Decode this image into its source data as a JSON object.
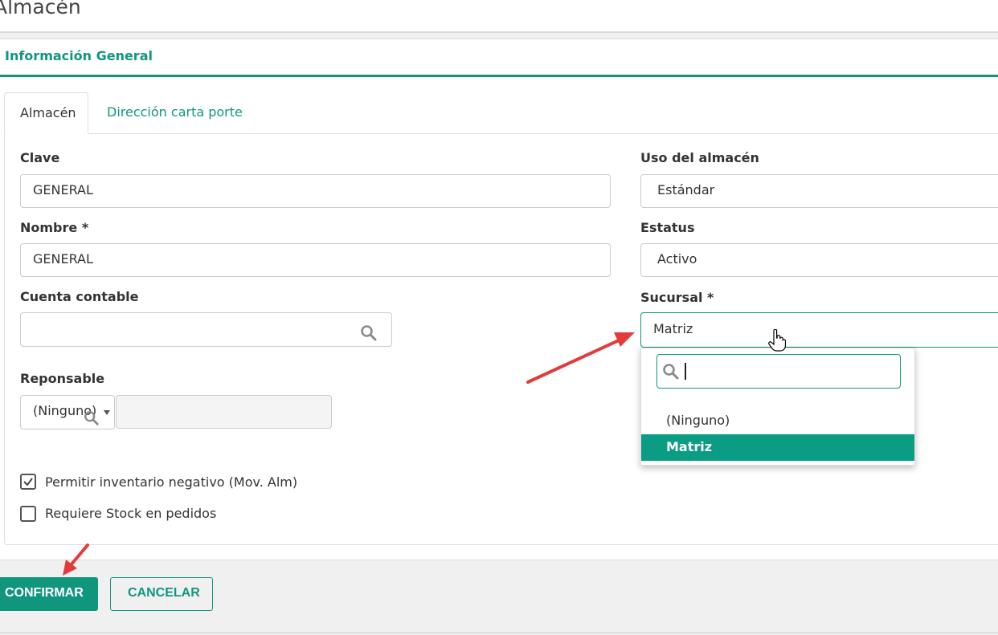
{
  "page": {
    "title": "Almacén"
  },
  "panel": {
    "title": "Información General"
  },
  "tabs": [
    {
      "label": "Almacén",
      "active": true
    },
    {
      "label": "Dirección carta porte",
      "active": false
    }
  ],
  "form": {
    "clave": {
      "label": "Clave",
      "value": "GENERAL"
    },
    "nombre": {
      "label": "Nombre *",
      "value": "GENERAL"
    },
    "cuenta_contable": {
      "label": "Cuenta contable",
      "value": ""
    },
    "responsable": {
      "label": "Reponsable",
      "selected": "(Ninguno)",
      "extra_value": ""
    },
    "uso": {
      "label": "Uso del almacén",
      "value": "Estándar"
    },
    "estatus": {
      "label": "Estatus",
      "value": "Activo"
    },
    "sucursal": {
      "label": "Sucursal *",
      "value": "Matriz",
      "search_value": "",
      "options": [
        "(Ninguno)",
        "Matriz"
      ],
      "highlighted": "Matriz"
    },
    "checkboxes": [
      {
        "label": "Permitir inventario negativo (Mov. Alm)",
        "checked": true
      },
      {
        "label": "Requiere Stock en pedidos",
        "checked": false
      }
    ]
  },
  "actions": {
    "confirm_label": "CONFIRMAR",
    "cancel_label": "CANCELAR"
  },
  "colors": {
    "accent": "#11967e",
    "highlight": "#0a9d83",
    "annotation_arrow": "#e03c3c"
  },
  "icons": {
    "search": "search-icon",
    "dropdown_caret": "caret-down-icon",
    "cursor": "hand-pointer-icon",
    "check": "check-icon"
  }
}
